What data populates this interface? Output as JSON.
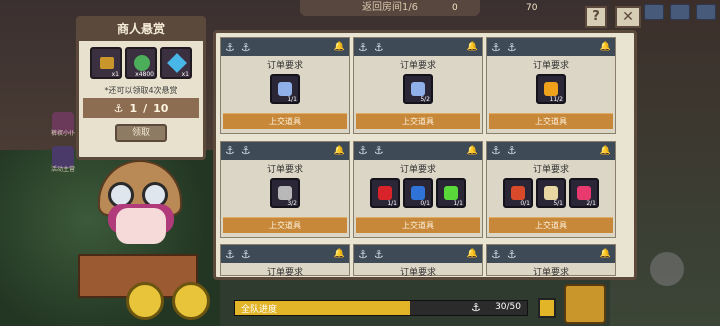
{
  "top_banner": "返回房间1/6",
  "top_resources": [
    "0",
    "70"
  ],
  "bounty": {
    "title": "商人悬赏",
    "rewards": [
      {
        "icon": "treasure-chest-icon",
        "count": "x1",
        "color": "#c9962c"
      },
      {
        "icon": "gem-pile-icon",
        "count": "x4800",
        "color": "#4cae5a"
      },
      {
        "icon": "blue-crystal-icon",
        "count": "x1",
        "color": "#49b6e8"
      }
    ],
    "note": "*还可以领取4次悬赏",
    "progress_current": "1",
    "progress_total": "10",
    "claim_label": "领取"
  },
  "side_labels": [
    "裤衩小仆",
    "活动主营"
  ],
  "orders": [
    {
      "title": "订单要求",
      "items": [
        {
          "icon": "blue-shard-icon",
          "qty": "1/1",
          "color": "#8fb0e8"
        }
      ],
      "submit": "上交道具"
    },
    {
      "title": "订单要求",
      "items": [
        {
          "icon": "blue-shard-icon",
          "qty": "5/2",
          "color": "#8fb0e8"
        }
      ],
      "submit": "上交道具"
    },
    {
      "title": "订单要求",
      "items": [
        {
          "icon": "goldfish-icon",
          "qty": "11/2",
          "color": "#f0a11c"
        }
      ],
      "submit": "上交道具"
    },
    {
      "title": "订单要求",
      "items": [
        {
          "icon": "silver-fish-icon",
          "qty": "3/2",
          "color": "#b8b8b8"
        }
      ],
      "submit": "上交道具"
    },
    {
      "title": "订单要求",
      "items": [
        {
          "icon": "red-flower-icon",
          "qty": "1/1",
          "color": "#d9232b"
        },
        {
          "icon": "blue-flower-icon",
          "qty": "0/1",
          "color": "#2f73d9"
        },
        {
          "icon": "green-flower-icon",
          "qty": "1/1",
          "color": "#5ad93a"
        }
      ],
      "submit": "上交道具"
    },
    {
      "title": "订单要求",
      "items": [
        {
          "icon": "crab-icon",
          "qty": "0/1",
          "color": "#d94a2a"
        },
        {
          "icon": "shell-icon",
          "qty": "5/1",
          "color": "#e8d7a2"
        },
        {
          "icon": "pink-coral-icon",
          "qty": "2/1",
          "color": "#e83a6e"
        }
      ],
      "submit": "上交道具"
    },
    {
      "title": "订单要求"
    },
    {
      "title": "订单要求"
    },
    {
      "title": "订单要求"
    }
  ],
  "team_progress": {
    "label": "全队进度",
    "value": "30/50",
    "ratio": 0.6
  }
}
